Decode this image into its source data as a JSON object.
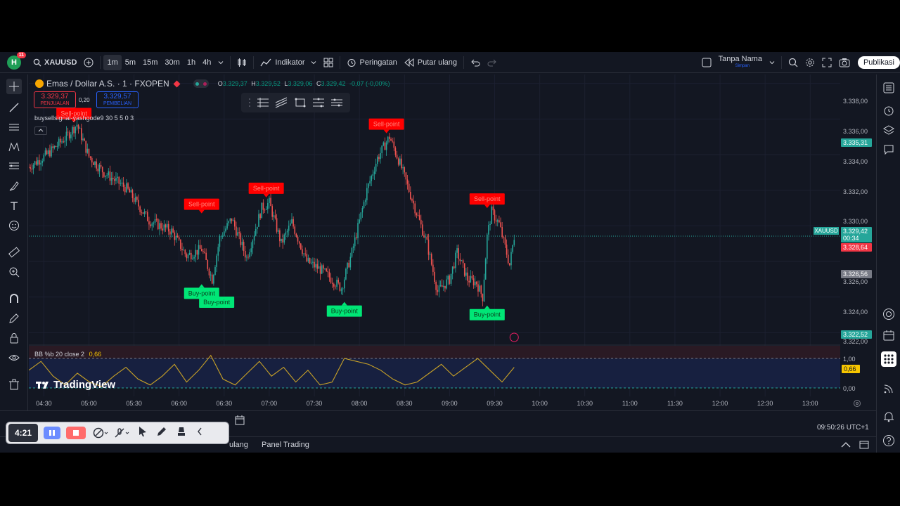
{
  "topbar": {
    "avatar_letter": "H",
    "notification_count": "11",
    "symbol": "XAUUSD",
    "timeframes": [
      "1m",
      "5m",
      "15m",
      "30m",
      "1h",
      "4h"
    ],
    "active_timeframe": "1m",
    "indicators_label": "Indikator",
    "alert_label": "Peringatan",
    "replay_label": "Putar ulang",
    "layout_name": "Tanpa Nama",
    "layout_status": "Simpan",
    "publish_label": "Publikasi"
  },
  "legend": {
    "title": "Emas / Dollar A.S. · 1 · FXOPEN",
    "open_label": "O",
    "open": "3.329,37",
    "high_label": "H",
    "high": "3.329,52",
    "low_label": "L",
    "low": "3.329,06",
    "close_label": "C",
    "close": "3.329,42",
    "change": "-0,07 (-0,00%)"
  },
  "trade_boxes": {
    "sell_price": "3.329,37",
    "sell_label": "PENJUALAN",
    "spread": "0,20",
    "buy_price": "3.329,57",
    "buy_label": "PEMBELIAN"
  },
  "indicator": {
    "name": "buysellsignal-yashgode9 30 5 5 0 3",
    "collapse_icon": "chevron-up-icon"
  },
  "signals": {
    "sell_text": "Sell-point",
    "buy_text": "Buy-point"
  },
  "oscillator": {
    "label": "BB %b 20 close 2",
    "value": "0,66",
    "axis": [
      "1,00",
      "0,66",
      "0,00"
    ]
  },
  "price_axis": {
    "labels": [
      "3.338,00",
      "3.336,00",
      "3.334,00",
      "3.332,00",
      "3.330,00",
      "3.326,00",
      "3.324,00",
      "3.322,00"
    ],
    "tags": {
      "high_tag": "3.335,31",
      "symbol_tag": "XAUUSD",
      "current": "3.329,42",
      "countdown": "00:34",
      "ask": "3.328,64",
      "low_marker": "3.326,56",
      "bottom_tag": "3.322,52"
    }
  },
  "time_axis": [
    "04:30",
    "05:00",
    "05:30",
    "06:00",
    "06:30",
    "07:00",
    "07:30",
    "08:00",
    "08:30",
    "09:00",
    "09:30",
    "10:00",
    "10:30",
    "11:00",
    "11:30",
    "12:00",
    "12:30",
    "13:00"
  ],
  "bottom": {
    "clock": "09:50:26 UTC+1",
    "panel_partial": "ulang",
    "panel_trading": "Panel Trading"
  },
  "recorder": {
    "time": "4:21"
  },
  "branding": {
    "logo_text": "TradingView"
  },
  "colors": {
    "background": "#131722",
    "up": "#26a69a",
    "down": "#ef5350",
    "sell_signal": "#ff0000",
    "buy_signal": "#00e676",
    "oscillator_line": "#c9a227"
  },
  "chart_data": {
    "type": "candlestick",
    "symbol": "XAUUSD",
    "ylim": [
      3322,
      3338.5
    ],
    "x_range": [
      "04:20",
      "13:20"
    ],
    "price_path": [
      [
        "04:20",
        3333.3
      ],
      [
        "04:32",
        3334.0
      ],
      [
        "04:45",
        3335.0
      ],
      [
        "04:52",
        3335.7
      ],
      [
        "05:00",
        3333.9
      ],
      [
        "05:10",
        3333.0
      ],
      [
        "05:25",
        3332.1
      ],
      [
        "05:40",
        3330.3
      ],
      [
        "05:55",
        3329.7
      ],
      [
        "06:05",
        3328.3
      ],
      [
        "06:15",
        3328.7
      ],
      [
        "06:22",
        3327.0
      ],
      [
        "06:27",
        3329.3
      ],
      [
        "06:35",
        3330.4
      ],
      [
        "06:45",
        3328.2
      ],
      [
        "06:55",
        3331.0
      ],
      [
        "07:00",
        3331.3
      ],
      [
        "07:08",
        3329.0
      ],
      [
        "07:15",
        3330.2
      ],
      [
        "07:25",
        3328.0
      ],
      [
        "07:35",
        3327.5
      ],
      [
        "07:48",
        3326.5
      ],
      [
        "07:55",
        3328.5
      ],
      [
        "08:05",
        3332.0
      ],
      [
        "08:12",
        3333.8
      ],
      [
        "08:20",
        3335.0
      ],
      [
        "08:27",
        3333.5
      ],
      [
        "08:35",
        3331.5
      ],
      [
        "08:45",
        3329.0
      ],
      [
        "08:52",
        3326.3
      ],
      [
        "09:00",
        3327.0
      ],
      [
        "09:05",
        3328.5
      ],
      [
        "09:12",
        3327.0
      ],
      [
        "09:18",
        3326.8
      ],
      [
        "09:22",
        3326.0
      ],
      [
        "09:25",
        3329.4
      ],
      [
        "09:28",
        3330.8
      ],
      [
        "09:33",
        3330.1
      ],
      [
        "09:40",
        3327.8
      ],
      [
        "09:43",
        3329.4
      ]
    ],
    "signals": [
      {
        "type": "sell",
        "time": "04:50",
        "price": 3335.6
      },
      {
        "type": "sell",
        "time": "06:15",
        "price": 3330.5
      },
      {
        "type": "buy",
        "time": "06:15",
        "price": 3327.0
      },
      {
        "type": "buy",
        "time": "06:25",
        "price": 3326.5
      },
      {
        "type": "sell",
        "time": "06:58",
        "price": 3331.4
      },
      {
        "type": "buy",
        "time": "07:50",
        "price": 3326.0
      },
      {
        "type": "sell",
        "time": "08:18",
        "price": 3335.0
      },
      {
        "type": "sell",
        "time": "09:25",
        "price": 3330.8
      },
      {
        "type": "buy",
        "time": "09:25",
        "price": 3325.8
      }
    ],
    "oscillator_series": [
      0.6,
      0.9,
      0.4,
      0.1,
      0.5,
      0.2,
      0.05,
      0.4,
      0.7,
      0.3,
      0.1,
      0.4,
      0.8,
      0.2,
      0.6,
      1.1,
      0.3,
      0.1,
      0.5,
      0.9,
      0.4,
      0.7,
      0.2,
      0.6,
      0.1,
      0.2,
      1.0,
      0.9,
      0.8,
      0.6,
      0.3,
      0.1,
      0.2,
      0.5,
      0.8,
      0.4,
      0.7,
      1.0,
      0.6,
      0.2,
      0.7
    ]
  }
}
